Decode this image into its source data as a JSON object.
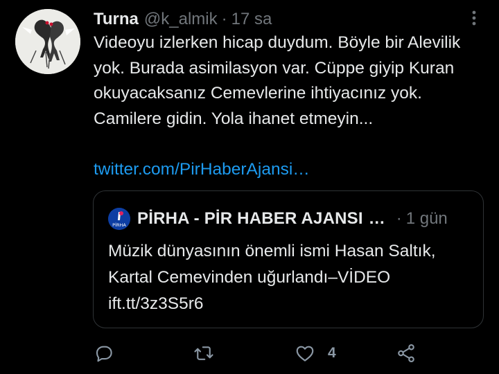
{
  "tweet": {
    "display_name": "Turna",
    "handle": "@k_almik",
    "separator": "·",
    "time": "17 sa",
    "text": "Videoyu izlerken hicap duydum. Böyle bir Alevilik yok. Burada asimilasyon var. Cüppe giyip Kuran okuyacaksanız Cemevlerine ihtiyacınız yok. Camilere gidin. Yola ihanet etmeyin...",
    "link": "twitter.com/PirHaberAjansi…"
  },
  "quote": {
    "display_name": "PİRHA - PİR HABER AJANSI",
    "ellipsis": "…",
    "separator": "·",
    "time": "1 gün",
    "avatar_text": "PİRHA",
    "text": "Müzik dünyasının önemli ismi Hasan Saltık, Kartal Cemevinden uğurlandı–VİDEO ift.tt/3z3S5r6"
  },
  "actions": {
    "like_count": "4"
  },
  "icons": {
    "more": "more-vertical-icon",
    "reply": "reply-icon",
    "retweet": "retweet-icon",
    "like": "heart-icon",
    "share": "share-icon"
  },
  "colors": {
    "background": "#000000",
    "text": "#e7e9ea",
    "muted": "#71767b",
    "link": "#1d9bf0",
    "border": "#2f3336",
    "quote_avatar_bg": "#0d3ea3",
    "quote_avatar_accent": "#e0245e"
  }
}
